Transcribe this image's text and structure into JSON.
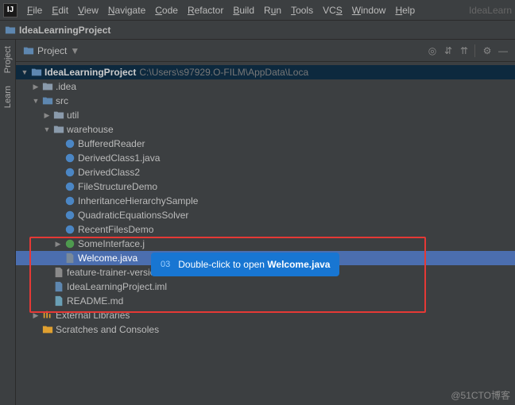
{
  "menubar": {
    "items": [
      "File",
      "Edit",
      "View",
      "Navigate",
      "Code",
      "Refactor",
      "Build",
      "Run",
      "Tools",
      "VCS",
      "Window",
      "Help"
    ],
    "faded": "IdeaLearn"
  },
  "crumb": {
    "project": "IdeaLearningProject"
  },
  "sidetabs": {
    "project": "Project",
    "learn": "Learn"
  },
  "panel": {
    "title": "Project"
  },
  "tree": {
    "root": "IdeaLearningProject",
    "root_path": "C:\\Users\\s97929.O-FILM\\AppData\\Loca",
    "idea": ".idea",
    "src": "src",
    "util": "util",
    "warehouse": "warehouse",
    "buffered": "BufferedReader",
    "derived1": "DerivedClass1.java",
    "derived2": "DerivedClass2",
    "filestruct": "FileStructureDemo",
    "inherit": "InheritanceHierarchySample",
    "quad": "QuadraticEquationsSolver",
    "recent": "RecentFilesDemo",
    "someint": "SomeInterface.j",
    "welcome": "Welcome.java",
    "feature": "feature-trainer-version...",
    "iml": "IdeaLearningProject.iml",
    "readme": "README.md",
    "extlib": "External Libraries",
    "scratch": "Scratches and Consoles"
  },
  "tip": {
    "num": "03",
    "text_pre": "Double-click to open ",
    "text_bold": "Welcome.java"
  },
  "watermark": "@51CTO博客"
}
